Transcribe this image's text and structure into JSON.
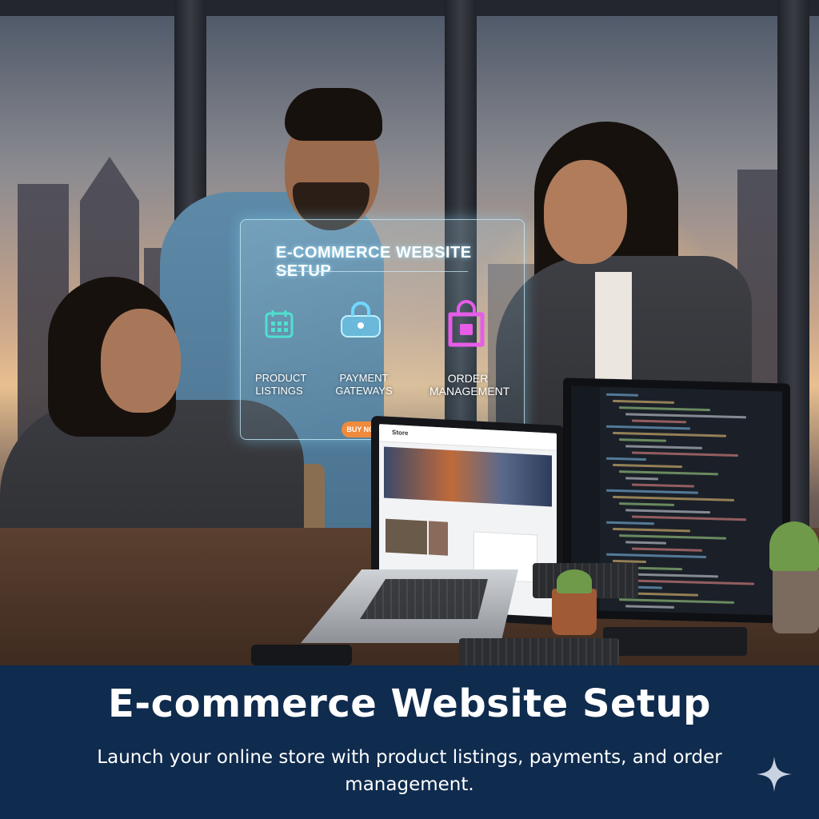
{
  "hologram": {
    "title": "E-COMMERCE WEBSITE SETUP",
    "features": [
      {
        "label_line1": "PRODUCT",
        "label_line2": "LISTINGS",
        "icon": "calendar-icon",
        "color": "#4fe0d0"
      },
      {
        "label_line1": "PAYMENT",
        "label_line2": "GATEWAYS",
        "icon": "lock-icon",
        "color": "#6fd8ff"
      },
      {
        "label_line1": "ORDER",
        "label_line2": "MANAGEMENT",
        "icon": "padlock-icon",
        "color": "#e65ce8"
      }
    ],
    "cta_label": "BUY NOW"
  },
  "laptop": {
    "site_name": "Store",
    "screen": "web-store-page"
  },
  "banner": {
    "headline": "E-commerce Website Setup",
    "subline": "Launch your online store with product listings, payments, and order management.",
    "accent_icon": "sparkle-icon",
    "background": "#0f2b4e",
    "text_color": "#ffffff"
  }
}
